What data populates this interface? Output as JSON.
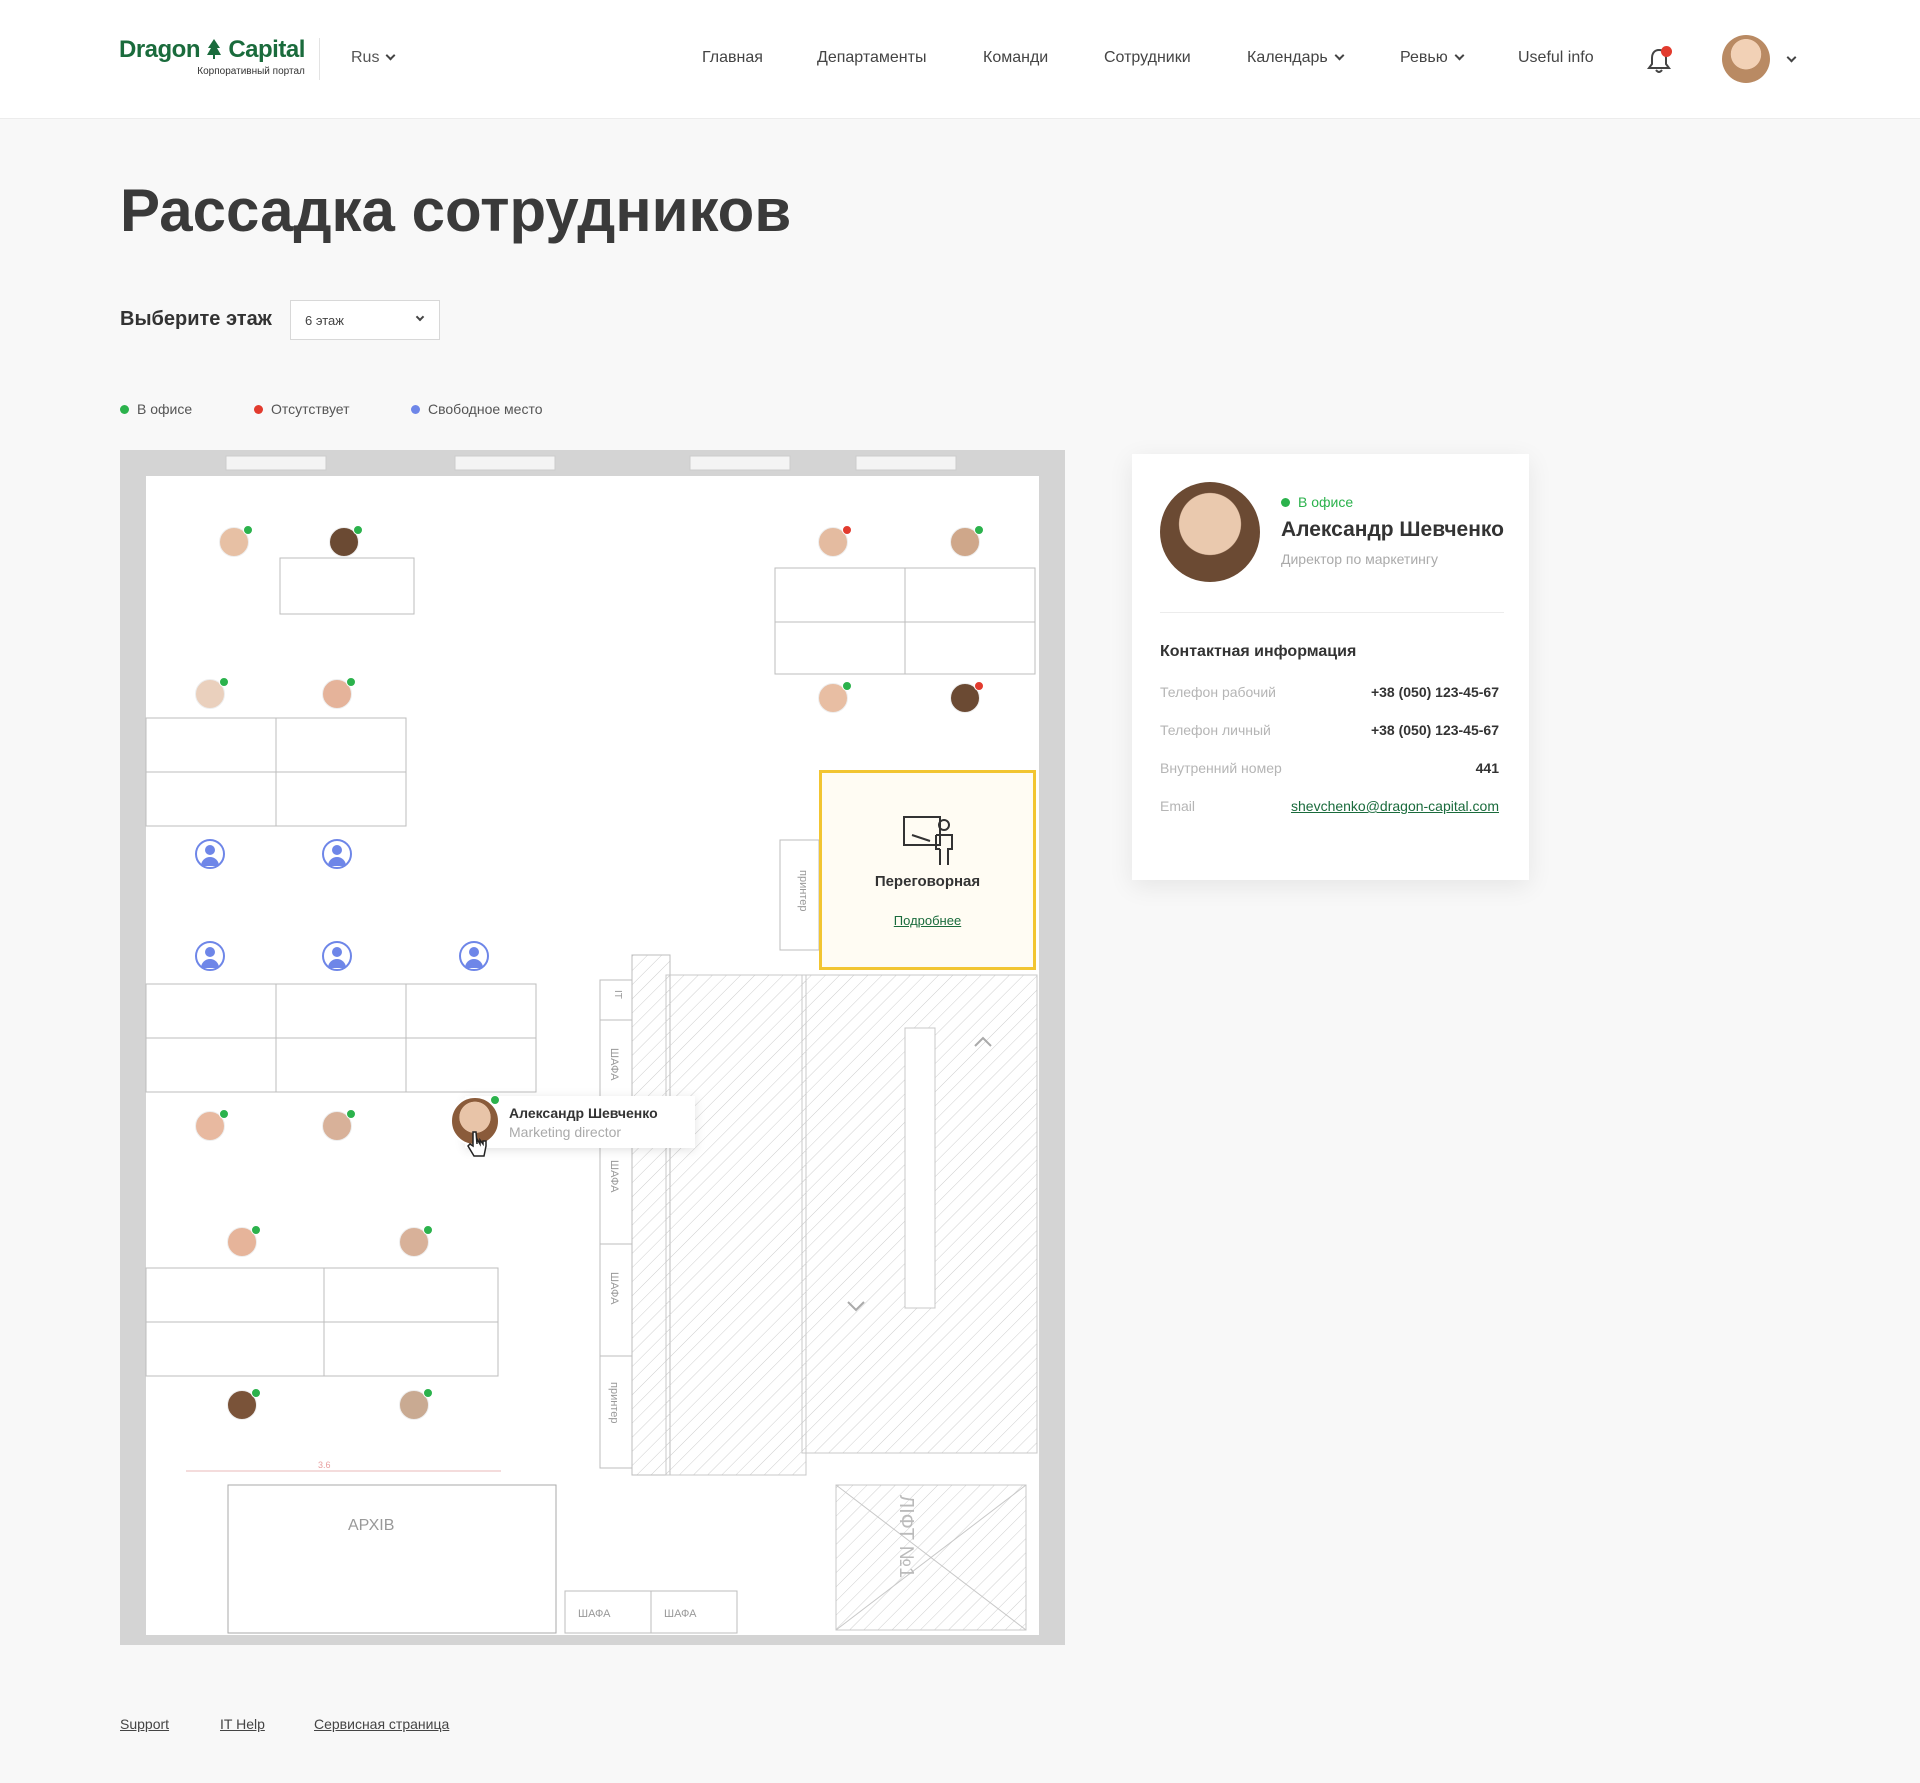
{
  "header": {
    "logo_title": "Dragon Capital",
    "logo_subtitle": "Корпоративный портал",
    "language": "Rus",
    "nav": [
      "Главная",
      "Департаменты",
      "Команди",
      "Сотрудники",
      "Календарь",
      "Ревью",
      "Useful info"
    ],
    "nav_dropdowns": [
      "Календарь",
      "Ревью"
    ],
    "icons": [
      "bell-icon",
      "user-avatar",
      "chevron-down-icon"
    ],
    "notification_dot_color": "#e23b2e"
  },
  "page": {
    "title": "Рассадка сотрудников",
    "floor_label": "Выберите этаж",
    "floor_value": "6 этаж"
  },
  "legend": {
    "in_office": "В офисе",
    "absent": "Отсутствует",
    "free": "Свободное место"
  },
  "colors": {
    "in_office": "#2bb24c",
    "absent": "#e23b2e",
    "free": "#6e86e8",
    "brand": "#1a6b3c",
    "meeting_border": "#f2c531"
  },
  "plan": {
    "labels": {
      "printer": "принтер",
      "it": "IT",
      "wardrobe": "ШАФА",
      "archive": "АРХІВ",
      "lift": "ЛІФТ №1",
      "dimension": "3.6"
    },
    "meeting_room": {
      "name": "Переговорная",
      "link": "Подробнее"
    },
    "tooltip": {
      "name": "Александр Шевченко",
      "role": "Marketing director"
    }
  },
  "profile": {
    "status": "В офисе",
    "name": "Александр Шевченко",
    "role": "Директор по маркетингу",
    "contacts_title": "Контактная информация",
    "contacts": [
      {
        "label": "Телефон рабочий",
        "value": "+38 (050) 123-45-67"
      },
      {
        "label": "Телефон личный",
        "value": "+38 (050) 123-45-67"
      },
      {
        "label": "Внутренний номер",
        "value": "441"
      },
      {
        "label": "Email",
        "value": "shevchenko@dragon-capital.com"
      }
    ]
  },
  "footer": {
    "links": [
      "Support",
      "IT Help",
      "Сервисная страница"
    ]
  }
}
